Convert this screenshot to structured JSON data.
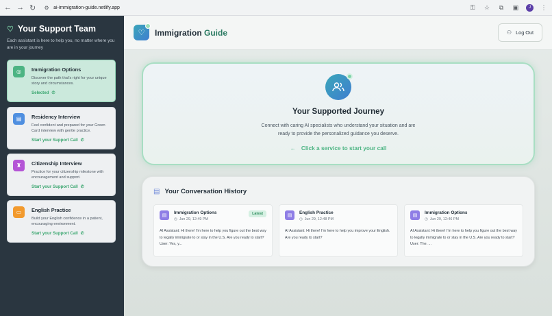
{
  "browser": {
    "back_icon": "arrow-left-icon",
    "url": "ai-immigration-guide.netlify.app",
    "profile_initial": "J"
  },
  "sidebar": {
    "title": "Your Support Team",
    "subtitle": "Each assistant is here to help you, no matter where you are in your journey",
    "items": [
      {
        "title": "Immigration Options",
        "description": "Discover the path that's right for your unique story and circumstances.",
        "action": "Selected",
        "selected": true,
        "icon_color": "#4cb483"
      },
      {
        "title": "Residency Interview",
        "description": "Feel confident and prepared for your Green Card interview with gentle practice.",
        "action": "Start your Support Call",
        "selected": false,
        "icon_color": "#4f8fe0"
      },
      {
        "title": "Citizenship Interview",
        "description": "Practice for your citizenship milestone with encouragement and support.",
        "action": "Start your Support Call",
        "selected": false,
        "icon_color": "#b455d6"
      },
      {
        "title": "English Practice",
        "description": "Build your English confidence in a patient, encouraging environment.",
        "action": "Start your Support Call",
        "selected": false,
        "icon_color": "#f29a2e"
      }
    ]
  },
  "header": {
    "title_part1": "Immigration",
    "title_part2": "Guide",
    "logout_label": "Log Out"
  },
  "journey": {
    "title": "Your Supported Journey",
    "text": "Connect with caring AI specialists who understand your situation and are ready to provide the personalized guidance you deserve.",
    "cta": "Click a service to start your call"
  },
  "history": {
    "title": "Your Conversation History",
    "items": [
      {
        "name": "Immigration Options",
        "time": "Jun 29, 12:49 PM",
        "badge": "Latest",
        "message": "AI Assistant: Hi there! I'm here to help you figure out the best way to legally immigrate to or stay in the U.S. Are you ready to start? User: Yes, y..."
      },
      {
        "name": "English Practice",
        "time": "Jun 29, 12:48 PM",
        "badge": "",
        "message": "AI Assistant: Hi there! I'm here to help you improve your English. Are you ready to start?"
      },
      {
        "name": "Immigration Options",
        "time": "Jun 29, 12:46 PM",
        "badge": "",
        "message": "AI Assistant: Hi there! I'm here to help you figure out the best way to legally immigrate to or stay in the U.S. Are you ready to start? User: The. ..."
      }
    ]
  }
}
